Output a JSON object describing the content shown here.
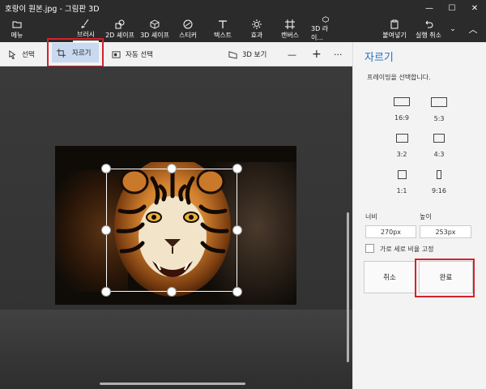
{
  "window": {
    "title": "호랑이 원본.jpg - 그림판 3D"
  },
  "ribbon": {
    "menu_label": "메뉴",
    "brush_label": "브러시",
    "shapes2d_label": "2D 셰이프",
    "shapes3d_label": "3D 셰이프",
    "sticker_label": "스티커",
    "text_label": "텍스트",
    "effects_label": "효과",
    "canvas_label": "캔버스",
    "library3d_label": "3D 라이...",
    "paste_label": "붙여넣기",
    "undo_label": "실행 취소"
  },
  "toolbar": {
    "select_label": "선택",
    "crop_label": "자르기",
    "auto_select_label": "자동 선택",
    "view3d_label": "3D 보기",
    "zoom_out": "—",
    "zoom_in": "+",
    "more": "···"
  },
  "panel": {
    "title": "자르기",
    "subtitle": "프레이밍을 선택합니다.",
    "ratios": [
      "16:9",
      "5:3",
      "3:2",
      "4:3",
      "1:1",
      "9:16"
    ],
    "width_label": "너비",
    "height_label": "높이",
    "width_value": "270px",
    "height_value": "253px",
    "lock_ratio_label": "가로 세로 비율 고정",
    "cancel_label": "취소",
    "done_label": "완료"
  },
  "colors": {
    "accent": "#1f6fbf",
    "highlight_red": "#d3232a",
    "chrome_dark": "#2b2b2b"
  }
}
